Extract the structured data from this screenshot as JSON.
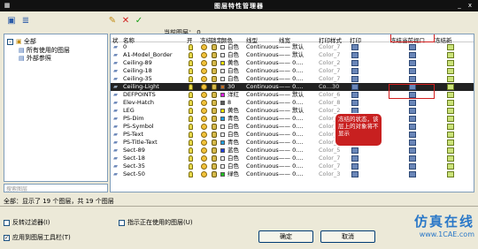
{
  "window": {
    "title": "图层特性管理器",
    "btn_min": "_",
    "btn_close": "x"
  },
  "toolbar": {
    "new_group": "▣",
    "filter": "≣",
    "new_layer": "✎",
    "delete": "✕",
    "set_current": "✓",
    "current_label": "当前图层： 0"
  },
  "tree": {
    "expand": "-",
    "root": "全部",
    "child1": "所有使用的图层",
    "child2": "外部参照",
    "search_placeholder": "搜索图层"
  },
  "columns": [
    "状",
    "名称",
    "开",
    "冻结",
    "锁定",
    "颜色",
    "线型",
    "线宽",
    "打印样式",
    "打印",
    "冻结当前视口",
    "冻结新"
  ],
  "rows": [
    {
      "name": "0",
      "color": "#ffffff",
      "cname": "白色",
      "ltype": "Continuous",
      "lw": "—— 默认",
      "ps": "Color_7"
    },
    {
      "name": "A1-Model_Border",
      "color": "#ffffff",
      "cname": "白色",
      "ltype": "Continuous",
      "lw": "—— 默认",
      "ps": "Color_7"
    },
    {
      "name": "Ceiling-89",
      "color": "#f0e000",
      "cname": "黄色",
      "ltype": "Continuous",
      "lw": "—— 0.…",
      "ps": "Color_2"
    },
    {
      "name": "Ceiling-18",
      "color": "#ffffff",
      "cname": "白色",
      "ltype": "Continuous",
      "lw": "—— 0.…",
      "ps": "Color_7"
    },
    {
      "name": "Ceiling-35",
      "color": "#ffffff",
      "cname": "白色",
      "ltype": "Continuous",
      "lw": "—— 0.…",
      "ps": "Color_7"
    },
    {
      "name": "Ceiling-Light",
      "color": "#c06a20",
      "cname": "30",
      "ltype": "Continuous",
      "lw": "—— 0.…",
      "ps": "Co…30",
      "selected": true
    },
    {
      "name": "DEFPOINTS",
      "color": "#e020e0",
      "cname": "洋红",
      "ltype": "Continuous",
      "lw": "—— 默认",
      "ps": "Color_6"
    },
    {
      "name": "Elev-Hatch",
      "color": "#5a5a5a",
      "cname": "8",
      "ltype": "Continuous",
      "lw": "—— 0.…",
      "ps": "Color_8"
    },
    {
      "name": "LEG",
      "color": "#f0e000",
      "cname": "黄色",
      "ltype": "Continuous",
      "lw": "—— 默认",
      "ps": "Color_2"
    },
    {
      "name": "PS-Dim",
      "color": "#20a0e0",
      "cname": "青色",
      "ltype": "Continuous",
      "lw": "—— 0.…",
      "ps": "Color_4"
    },
    {
      "name": "PS-Symbol",
      "color": "#ffffff",
      "cname": "白色",
      "ltype": "Continuous",
      "lw": "—— 0.…",
      "ps": "Color_7"
    },
    {
      "name": "PS-Text",
      "color": "#ffffff",
      "cname": "白色",
      "ltype": "Continuous",
      "lw": "—— 0.…",
      "ps": "Color_7"
    },
    {
      "name": "PS-Title-Text",
      "color": "#20a0e0",
      "cname": "青色",
      "ltype": "Continuous",
      "lw": "—— 0.…",
      "ps": "Color_4"
    },
    {
      "name": "Sect-89",
      "color": "#2040e0",
      "cname": "蓝色",
      "ltype": "Continuous",
      "lw": "—— 0.…",
      "ps": "Color_5"
    },
    {
      "name": "Sect-18",
      "color": "#ffffff",
      "cname": "白色",
      "ltype": "Continuous",
      "lw": "—— 0.…",
      "ps": "Color_7"
    },
    {
      "name": "Sect-35",
      "color": "#ffffff",
      "cname": "白色",
      "ltype": "Continuous",
      "lw": "—— 0.…",
      "ps": "Color_7"
    },
    {
      "name": "Sect-50",
      "color": "#20c020",
      "cname": "绿色",
      "ltype": "Continuous",
      "lw": "—— 0.…",
      "ps": "Color_3"
    }
  ],
  "callout": "冻结的状态，该层上的对象将不显示",
  "status": "全部：显示了 19 个图层，共 19 个图层",
  "invert_filter": "反转过滤器(I)",
  "show_used": "指示正在使用的图层(U)",
  "apply_toolbar": "应用到图层工具栏(T)",
  "buttons": {
    "ok": "确定",
    "cancel": "取消"
  },
  "watermark": {
    "line1": "仿真在线",
    "line2": "www.1CAE.com"
  }
}
